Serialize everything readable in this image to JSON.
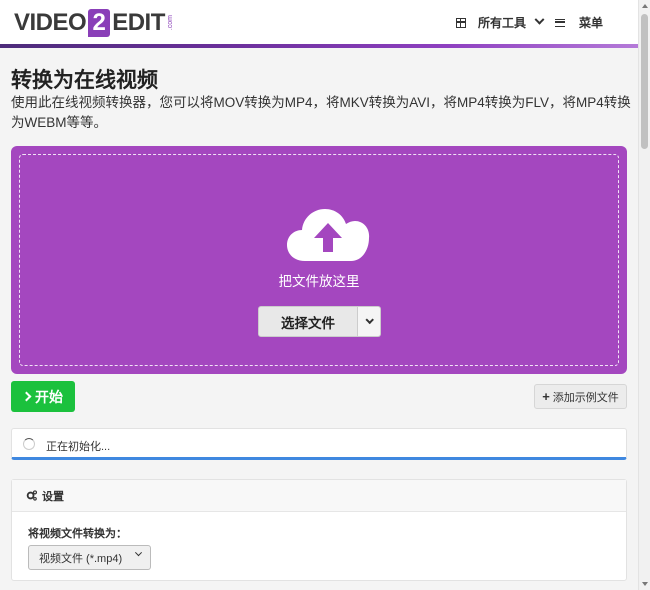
{
  "header": {
    "logo_left": "VIDEO",
    "logo_number": "2",
    "logo_right": "EDIT",
    "logo_com": ".com",
    "tools_label": "所有工具",
    "menu_label": "菜单"
  },
  "page": {
    "title": "转换为在线视频",
    "description": "使用此在线视频转换器，您可以将MOV转换为MP4，将MKV转换为AVI，将MP4转换为FLV，将MP4转换为WEBM等等。"
  },
  "dropzone": {
    "drop_text": "把文件放这里",
    "choose_label": "选择文件"
  },
  "actions": {
    "start_label": "开始",
    "sample_label": "添加示例文件"
  },
  "status": {
    "init_text": "正在初始化..."
  },
  "settings": {
    "title": "设置",
    "convert_label": "将视频文件转换为：",
    "selected_format": "视频文件 (*.mp4)"
  },
  "colors": {
    "accent_purple": "#a447bf",
    "start_green": "#1bc13d",
    "progress_blue": "#3f88e0"
  }
}
